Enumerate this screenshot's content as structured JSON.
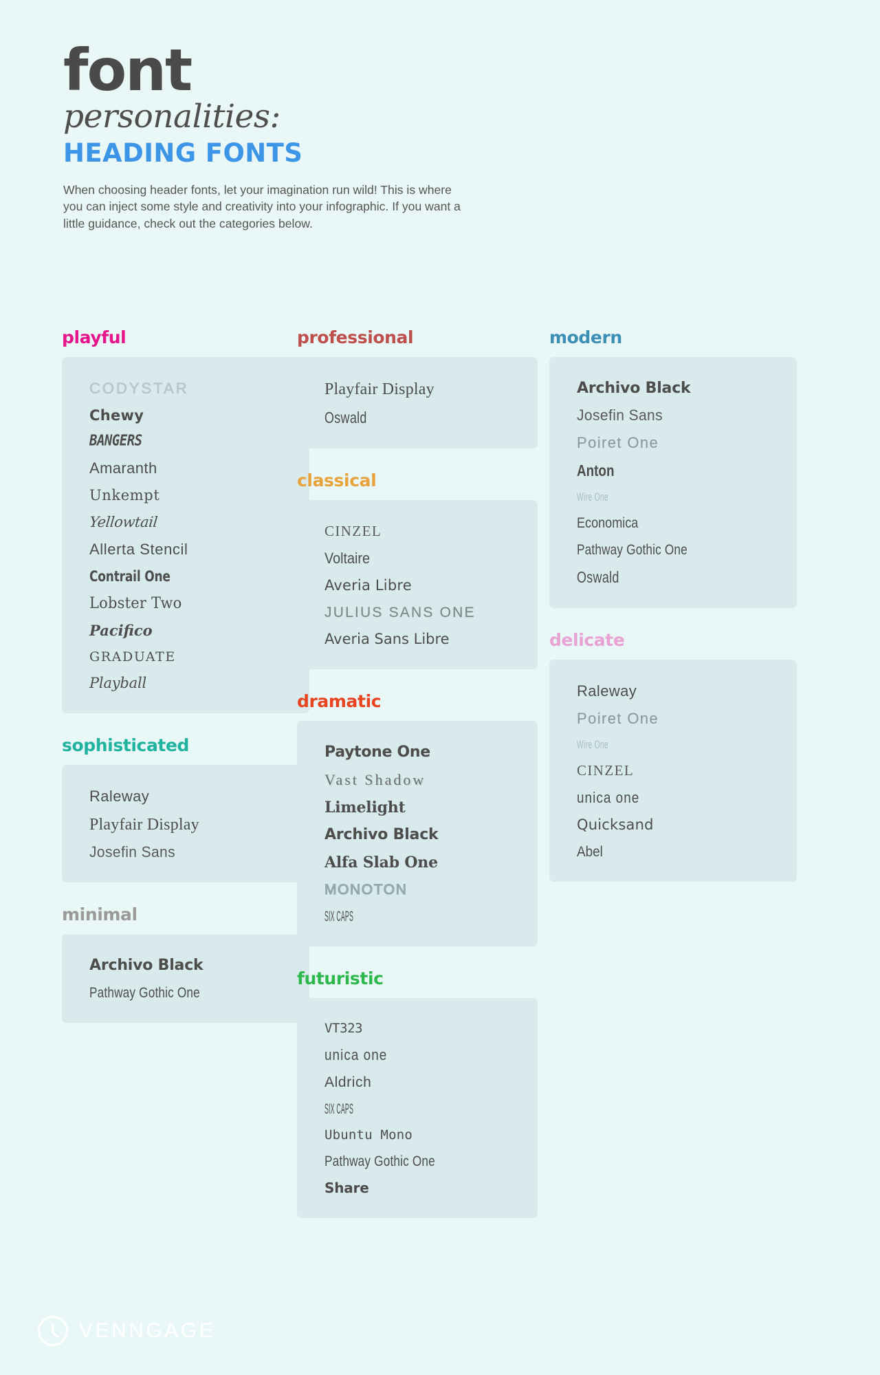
{
  "header": {
    "title_main": "font",
    "title_sub": "personalities:",
    "title_accent": "HEADING FONTS",
    "intro": "When choosing header fonts, let your imagination run wild! This is where you can inject some style and creativity into your infographic. If you want a little guidance, check out the categories below."
  },
  "colors": {
    "background": "#eaf7f7",
    "card": "#d8eaec",
    "title_dark": "#4a4a48",
    "title_accent": "#3d95e8",
    "body_text": "#555553",
    "sample_text": "#4d4d4b",
    "playful": "#e8148c",
    "sophisticated": "#20b4a0",
    "minimal": "#9a9a98",
    "professional": "#bf4f4c",
    "classical": "#e8a33d",
    "dramatic": "#e8441f",
    "modern": "#3d8fb5",
    "delicate": "#e8a3d4",
    "futuristic": "#2db84d",
    "logo": "#ffffff"
  },
  "columns": [
    {
      "name": "column-left",
      "groups": [
        {
          "label": "playful",
          "color_key": "playful",
          "fonts": [
            {
              "name": "CODYSTAR",
              "style": "f-codystar"
            },
            {
              "name": "Chewy",
              "style": "f-chewy"
            },
            {
              "name": "BANGERS",
              "style": "f-bangers"
            },
            {
              "name": "Amaranth",
              "style": "f-amaranth"
            },
            {
              "name": "Unkempt",
              "style": "f-unkempt"
            },
            {
              "name": "Yellowtail",
              "style": "f-yellowtail"
            },
            {
              "name": "Allerta Stencil",
              "style": "f-allerta"
            },
            {
              "name": "Contrail One",
              "style": "f-contrail"
            },
            {
              "name": "Lobster Two",
              "style": "f-lobster"
            },
            {
              "name": "Pacifico",
              "style": "f-pacifico"
            },
            {
              "name": "GRADUATE",
              "style": "f-graduate"
            },
            {
              "name": "Playball",
              "style": "f-playball"
            }
          ]
        },
        {
          "label": "sophisticated",
          "color_key": "sophisticated",
          "fonts": [
            {
              "name": "Raleway",
              "style": "f-raleway"
            },
            {
              "name": "Playfair Display",
              "style": "f-playfair"
            },
            {
              "name": "Josefin Sans",
              "style": "f-josefin"
            }
          ]
        },
        {
          "label": "minimal",
          "color_key": "minimal",
          "fonts": [
            {
              "name": "Archivo Black",
              "style": "f-archivo"
            },
            {
              "name": "Pathway Gothic One",
              "style": "f-pathway"
            }
          ]
        }
      ]
    },
    {
      "name": "column-middle",
      "groups": [
        {
          "label": "professional",
          "color_key": "professional",
          "fonts": [
            {
              "name": "Playfair Display",
              "style": "f-playfair"
            },
            {
              "name": "Oswald",
              "style": "f-oswald"
            }
          ]
        },
        {
          "label": "classical",
          "color_key": "classical",
          "fonts": [
            {
              "name": "CINZEL",
              "style": "f-cinzel"
            },
            {
              "name": "Voltaire",
              "style": "f-voltaire"
            },
            {
              "name": "Averia Libre",
              "style": "f-averia"
            },
            {
              "name": "JULIUS SANS ONE",
              "style": "f-julius"
            },
            {
              "name": "Averia Sans Libre",
              "style": "f-averiasans"
            }
          ]
        },
        {
          "label": "dramatic",
          "color_key": "dramatic",
          "fonts": [
            {
              "name": "Paytone One",
              "style": "f-paytone"
            },
            {
              "name": "Vast Shadow",
              "style": "f-vastshadow"
            },
            {
              "name": "Limelight",
              "style": "f-limelight"
            },
            {
              "name": "Archivo Black",
              "style": "f-archivo"
            },
            {
              "name": "Alfa Slab One",
              "style": "f-alfaslab"
            },
            {
              "name": "MONOTON",
              "style": "f-monoton"
            },
            {
              "name": "SIX CAPS",
              "style": "f-sixcaps"
            }
          ]
        },
        {
          "label": "futuristic",
          "color_key": "futuristic",
          "fonts": [
            {
              "name": "VT323",
              "style": "f-vt323"
            },
            {
              "name": "unica one",
              "style": "f-unicaone"
            },
            {
              "name": "Aldrich",
              "style": "f-aldrich"
            },
            {
              "name": "SIX CAPS",
              "style": "f-sixcaps"
            },
            {
              "name": "Ubuntu Mono",
              "style": "f-ubuntumono"
            },
            {
              "name": "Pathway Gothic One",
              "style": "f-pathway"
            },
            {
              "name": "Share",
              "style": "f-share"
            }
          ]
        }
      ]
    },
    {
      "name": "column-right",
      "groups": [
        {
          "label": "modern",
          "color_key": "modern",
          "fonts": [
            {
              "name": "Archivo Black",
              "style": "f-archivo"
            },
            {
              "name": "Josefin Sans",
              "style": "f-josefin"
            },
            {
              "name": "Poiret One",
              "style": "f-poiret"
            },
            {
              "name": "Anton",
              "style": "f-anton"
            },
            {
              "name": "Wire One",
              "style": "f-wireone"
            },
            {
              "name": "Economica",
              "style": "f-economica"
            },
            {
              "name": "Pathway Gothic One",
              "style": "f-pathway"
            },
            {
              "name": "Oswald",
              "style": "f-oswald"
            }
          ]
        },
        {
          "label": "delicate",
          "color_key": "delicate",
          "fonts": [
            {
              "name": "Raleway",
              "style": "f-raleway"
            },
            {
              "name": "Poiret One",
              "style": "f-poiret"
            },
            {
              "name": "Wire One",
              "style": "f-wireone"
            },
            {
              "name": "CINZEL",
              "style": "f-cinzel"
            },
            {
              "name": "unica one",
              "style": "f-unicaone"
            },
            {
              "name": "Quicksand",
              "style": "f-quicksand"
            },
            {
              "name": "Abel",
              "style": "f-abel"
            }
          ]
        }
      ]
    }
  ],
  "footer": {
    "logo_text": "VENNGAGE"
  }
}
